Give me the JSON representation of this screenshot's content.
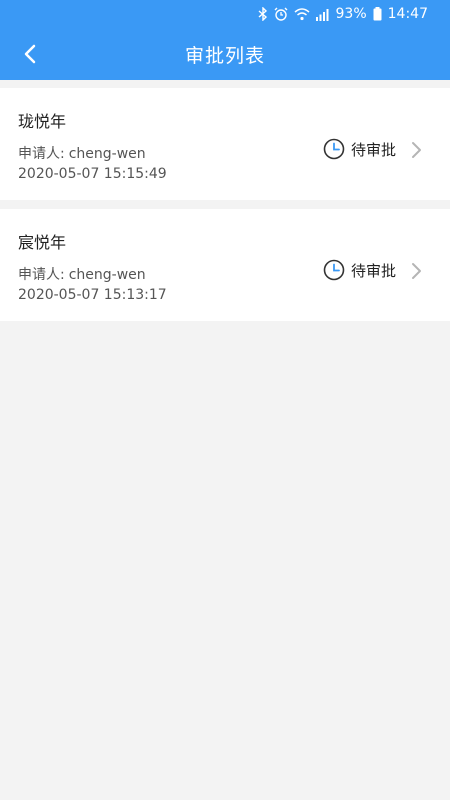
{
  "status_bar": {
    "battery_pct": "93%",
    "time": "14:47",
    "icons": [
      "bluetooth-icon",
      "alarm-icon",
      "wifi-icon",
      "signal-icon",
      "battery-icon"
    ]
  },
  "header": {
    "title": "审批列表",
    "back_icon": "chevron-left-icon",
    "accent_color": "#3a99f5"
  },
  "approvals": [
    {
      "title": "珑悦年",
      "applicant_label": "申请人:",
      "applicant": "cheng-wen",
      "datetime": "2020-05-07 15:15:49",
      "status": "待审批",
      "status_icon": "clock-icon"
    },
    {
      "title": "宸悦年",
      "applicant_label": "申请人:",
      "applicant": "cheng-wen",
      "datetime": "2020-05-07 15:13:17",
      "status": "待审批",
      "status_icon": "clock-icon"
    }
  ]
}
